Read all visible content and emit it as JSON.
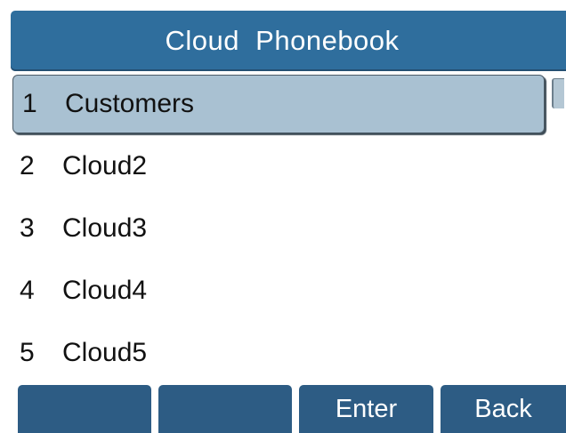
{
  "header": {
    "title": "Cloud  Phonebook"
  },
  "list": {
    "items": [
      {
        "index": "1",
        "label": "Customers",
        "selected": true
      },
      {
        "index": "2",
        "label": "Cloud2",
        "selected": false
      },
      {
        "index": "3",
        "label": "Cloud3",
        "selected": false
      },
      {
        "index": "4",
        "label": "Cloud4",
        "selected": false
      },
      {
        "index": "5",
        "label": "Cloud5",
        "selected": false
      }
    ]
  },
  "softkeys": {
    "key1": "",
    "key2": "",
    "key3": "Enter",
    "key4": "Back"
  },
  "colors": {
    "header_bg": "#2f6e9d",
    "selection_bg": "#a9c1d2",
    "softkey_bg": "#2d5c84"
  }
}
